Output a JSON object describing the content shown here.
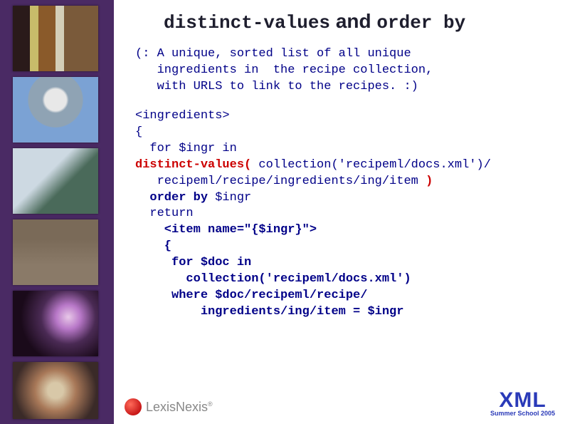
{
  "title": {
    "part1": "distinct-values",
    "joiner": " and ",
    "part2": "order by"
  },
  "comment": "(: A unique, sorted list of all unique\n   ingredients in  the recipe collection,\n   with URLS to link to the recipes. :)",
  "code": {
    "l1": "<ingredients>",
    "l2": "{",
    "l3a": "  for $ingr in",
    "l4a": "distinct-values(",
    "l4b": " collection('recipeml/docs.xml')/",
    "l5": "   recipeml/recipe/ingredients/ing/item ",
    "l5end": ")",
    "l6": "  order by",
    "l6b": " $ingr",
    "l7": "  return",
    "l8": "    <item name=\"{$ingr}\">",
    "l9": "    {",
    "l10": "     for $doc in",
    "l11": "       collection('recipeml/docs.xml')",
    "l12": "     where $doc/recipeml/recipe/",
    "l13": "         ingredients/ing/item = $ingr"
  },
  "footer": {
    "lexis": "LexisNexis",
    "reg": "®",
    "xml": "XML",
    "school": "Summer School 2005"
  }
}
